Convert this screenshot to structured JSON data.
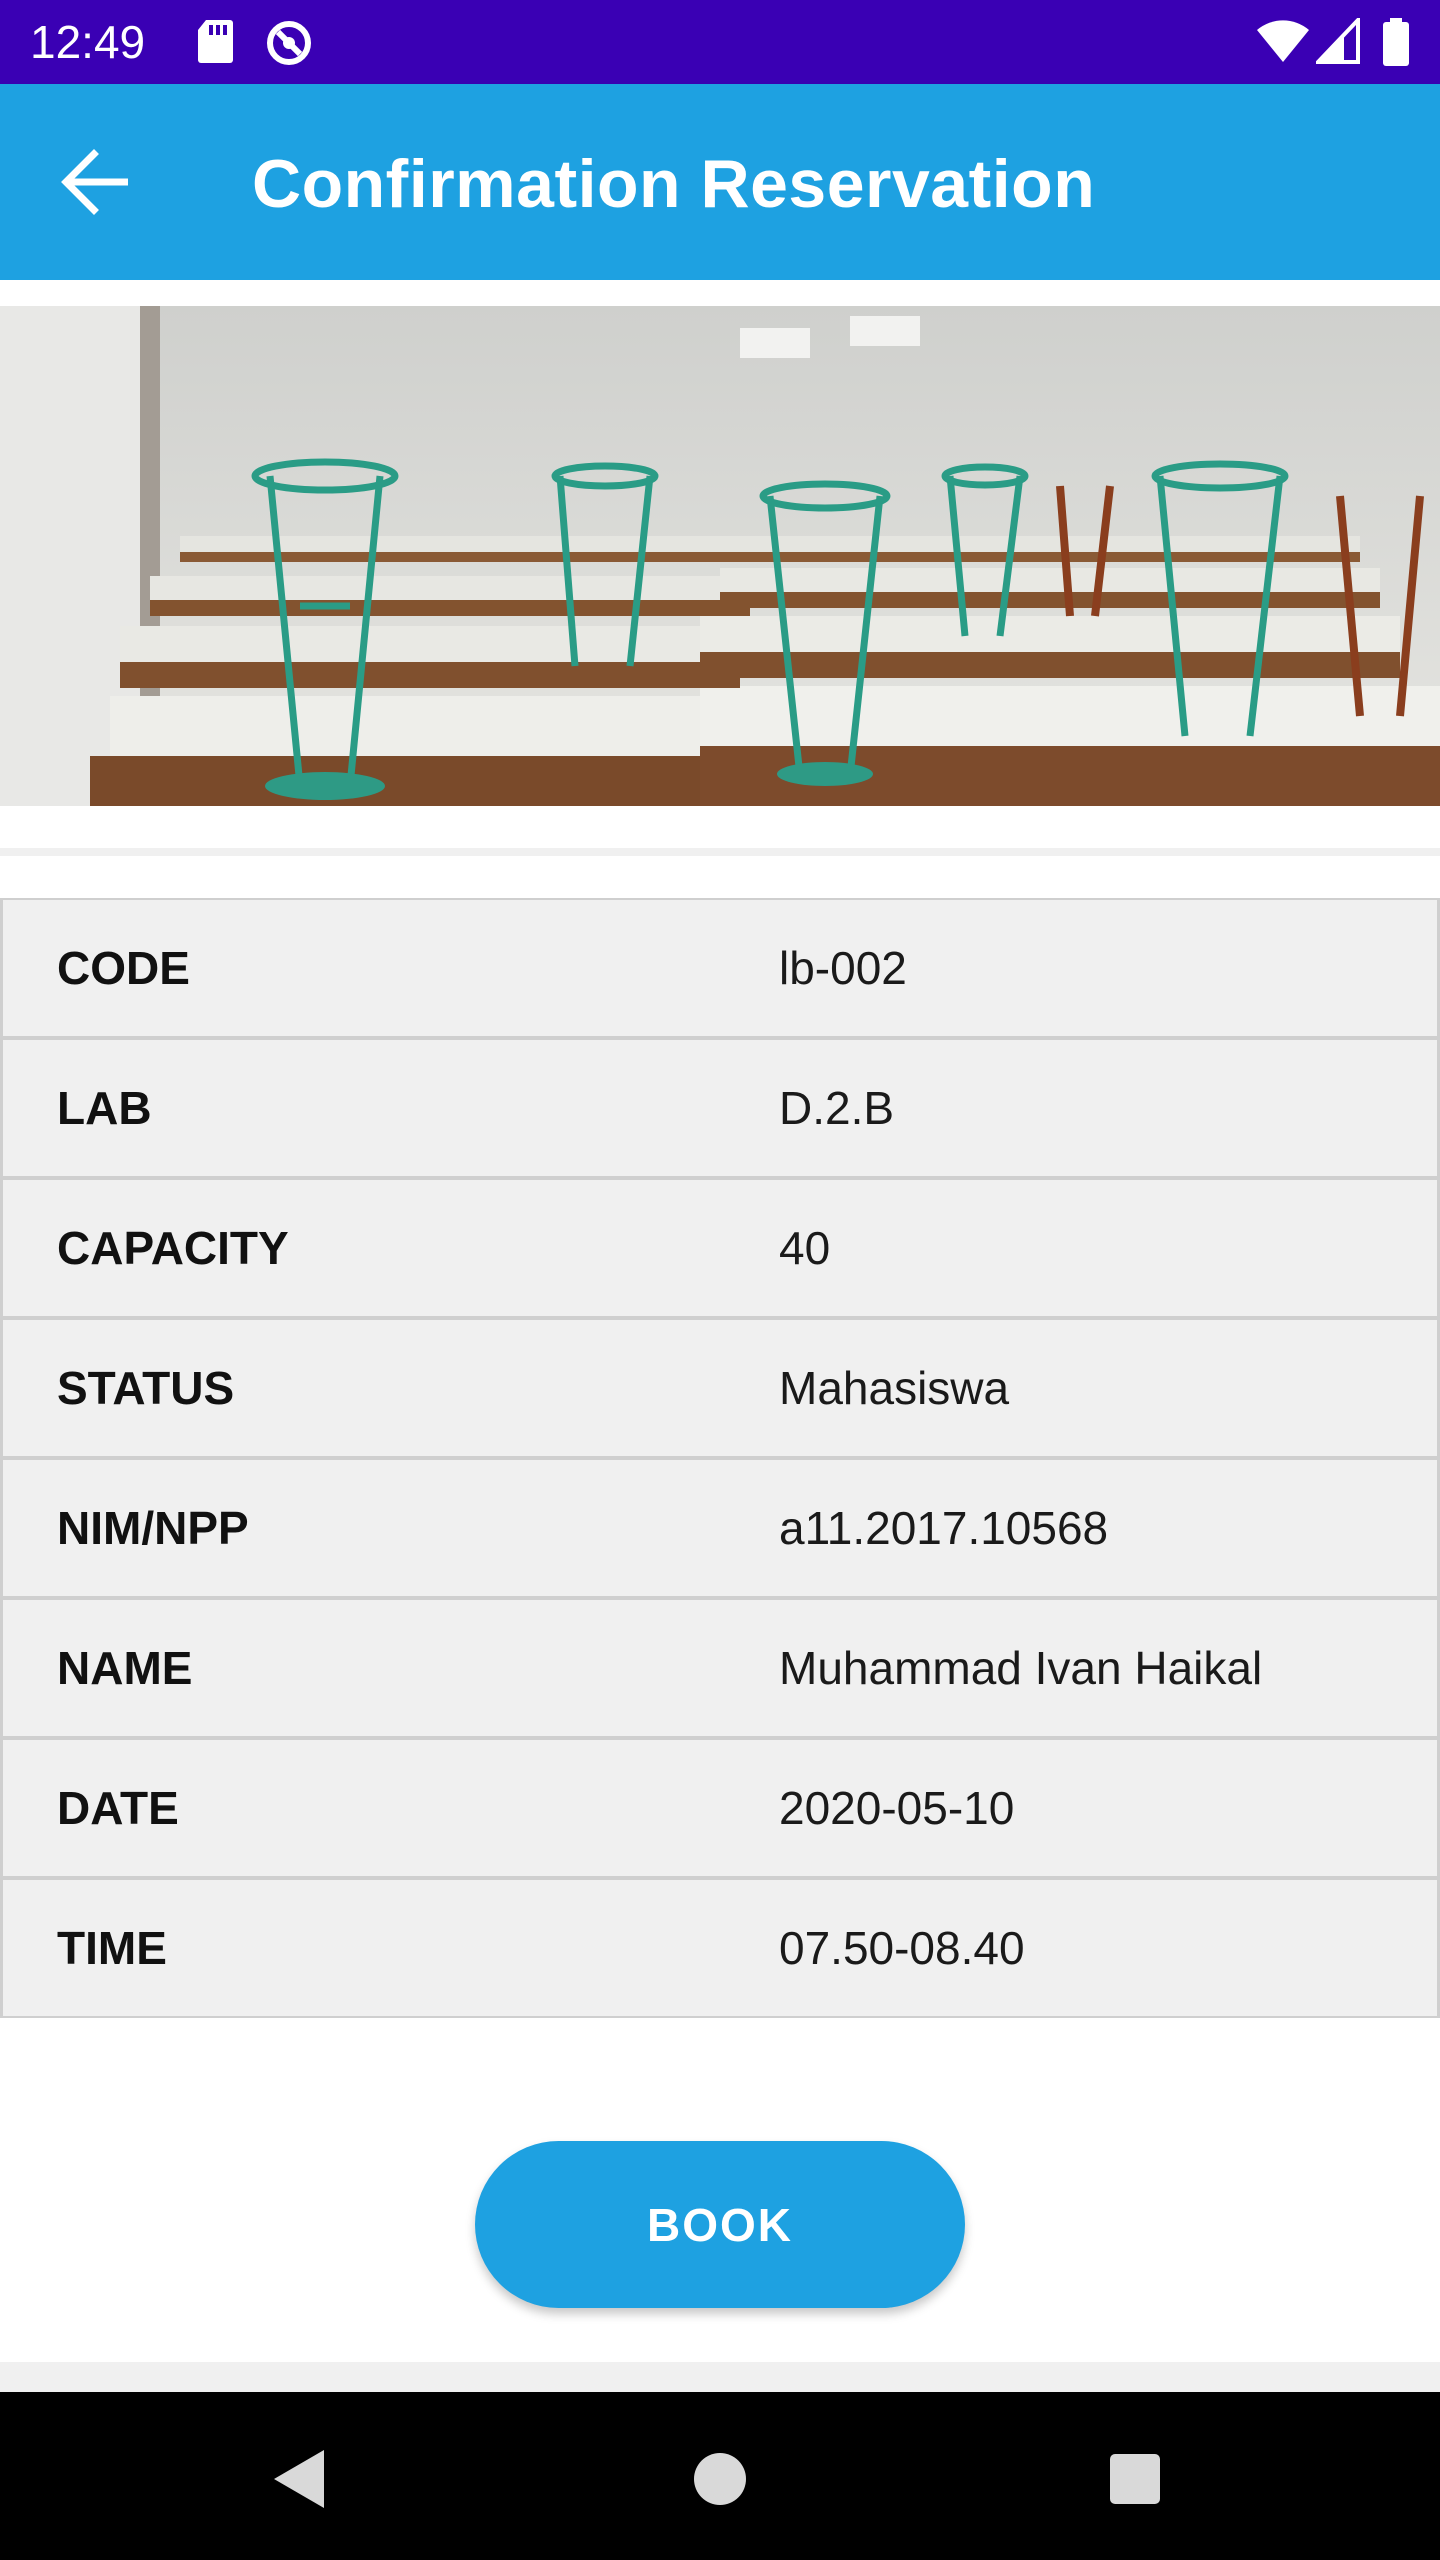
{
  "status_bar": {
    "time": "12:49",
    "left_icons": [
      "sd-card-icon",
      "sync-icon"
    ],
    "right_icons": [
      "wifi-icon",
      "cellular-signal-icon",
      "battery-icon"
    ],
    "color": "#3a00b4"
  },
  "app_bar": {
    "title": "Confirmation Reservation",
    "back_icon": "arrow-back-icon",
    "color": "#1ea1e1"
  },
  "lab_photo": {
    "description_icon": "lab-room-photo"
  },
  "details": [
    {
      "label": "CODE",
      "value": "lb-002"
    },
    {
      "label": "LAB",
      "value": "D.2.B"
    },
    {
      "label": "CAPACITY",
      "value": "40"
    },
    {
      "label": "STATUS",
      "value": "Mahasiswa"
    },
    {
      "label": "NIM/NPP",
      "value": "a11.2017.10568"
    },
    {
      "label": "NAME",
      "value": "Muhammad Ivan Haikal"
    },
    {
      "label": "DATE",
      "value": "2020-05-10"
    },
    {
      "label": "TIME",
      "value": "07.50-08.40"
    }
  ],
  "actions": {
    "book_label": "BOOK",
    "book_color": "#1ea1e1"
  },
  "nav_bar": {
    "icons": [
      "nav-back-icon",
      "nav-home-icon",
      "nav-recents-icon"
    ]
  }
}
